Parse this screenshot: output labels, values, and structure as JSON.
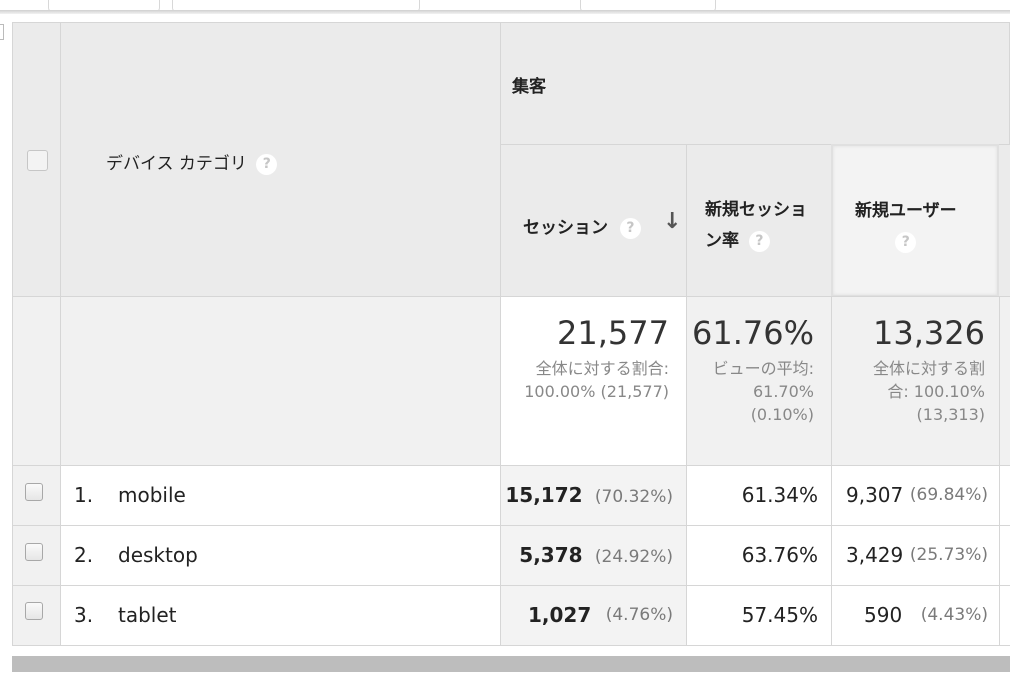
{
  "header": {
    "dimension_label": "デバイス カテゴリ",
    "group_label": "集客",
    "help_glyph": "?",
    "columns": [
      {
        "label": "セッション",
        "sorted": "descending"
      },
      {
        "label_line1": "新規セッショ",
        "label_line2": "ン率"
      },
      {
        "label": "新規ユーザー"
      }
    ],
    "sort_arrow": "↓"
  },
  "totals": {
    "sessions": {
      "value": "21,577",
      "note_line1": "全体に対する割合:",
      "note_line2": "100.00% (21,577)"
    },
    "new_session_rate": {
      "value": "61.76%",
      "note_line1": "ビューの平均:",
      "note_line2": "61.70%",
      "note_line3": "(0.10%)"
    },
    "new_users": {
      "value": "13,326",
      "note_line1": "全体に対する割",
      "note_line2": "合: 100.10%",
      "note_line3": "(13,313)"
    }
  },
  "rows": [
    {
      "index": "1.",
      "device": "mobile",
      "sessions": "15,172",
      "sessions_pct": "(70.32%)",
      "new_session_rate": "61.34%",
      "new_users": "9,307",
      "new_users_pct": "(69.84%)"
    },
    {
      "index": "2.",
      "device": "desktop",
      "sessions": "5,378",
      "sessions_pct": "(24.92%)",
      "new_session_rate": "63.76%",
      "new_users": "3,429",
      "new_users_pct": "(25.73%)"
    },
    {
      "index": "3.",
      "device": "tablet",
      "sessions": "1,027",
      "sessions_pct": "(4.76%)",
      "new_session_rate": "57.45%",
      "new_users": "590",
      "new_users_pct": "(4.43%)"
    }
  ]
}
